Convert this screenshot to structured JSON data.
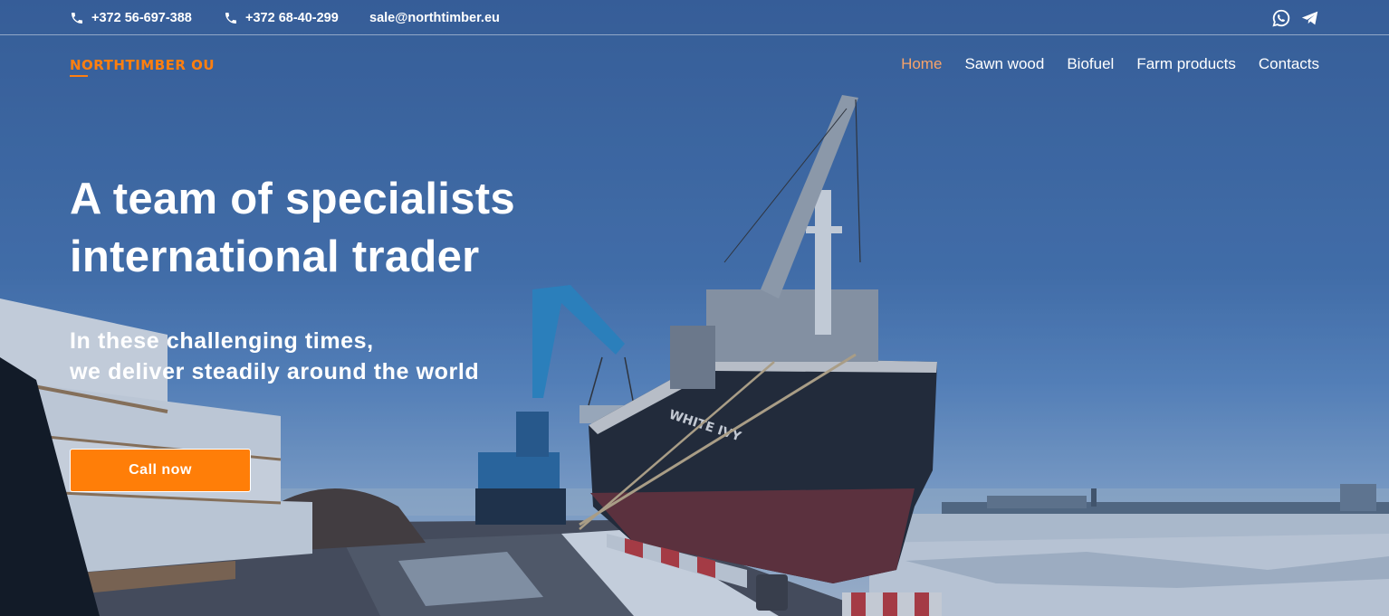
{
  "topbar": {
    "phone1": "+372 56-697-388",
    "phone2": "+372 68-40-299",
    "email": "sale@northtimber.eu",
    "social": [
      "whatsapp-icon",
      "telegram-icon"
    ]
  },
  "brand": {
    "name": "NORTHTIMBER OU",
    "color": "#ff7f0f"
  },
  "nav": {
    "items": [
      "Home",
      "Sawn wood",
      "Biofuel",
      "Farm products",
      "Contacts"
    ],
    "active": "Home",
    "active_color": "#f6a36a"
  },
  "hero": {
    "title_line1": "A team of specialists",
    "title_line2": "international trader",
    "subtitle_line1": "In these challenging times,",
    "subtitle_line2": "we deliver steadily around the world",
    "cta_label": "Call now",
    "cta_color": "#ff7e08",
    "ship_name": "WHITE IVY"
  }
}
